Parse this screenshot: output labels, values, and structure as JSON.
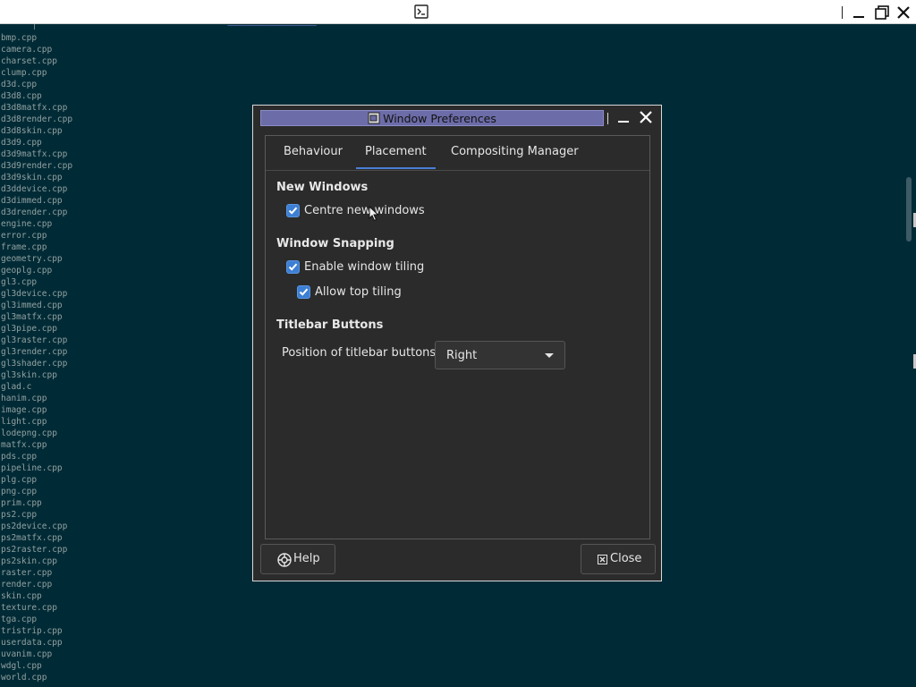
{
  "terminal": {
    "icon": "terminal-icon",
    "files": [
      "bmp.cpp",
      "camera.cpp",
      "charset.cpp",
      "clump.cpp",
      "d3d.cpp",
      "d3d8.cpp",
      "d3d8matfx.cpp",
      "d3d8render.cpp",
      "d3d8skin.cpp",
      "d3d9.cpp",
      "d3d9matfx.cpp",
      "d3d9render.cpp",
      "d3d9skin.cpp",
      "d3ddevice.cpp",
      "d3dimmed.cpp",
      "d3drender.cpp",
      "engine.cpp",
      "error.cpp",
      "frame.cpp",
      "geometry.cpp",
      "geoplg.cpp",
      "gl3.cpp",
      "gl3device.cpp",
      "gl3immed.cpp",
      "gl3matfx.cpp",
      "gl3pipe.cpp",
      "gl3raster.cpp",
      "gl3render.cpp",
      "gl3shader.cpp",
      "gl3skin.cpp",
      "glad.c",
      "hanim.cpp",
      "image.cpp",
      "light.cpp",
      "lodepng.cpp",
      "matfx.cpp",
      "pds.cpp",
      "pipeline.cpp",
      "plg.cpp",
      "png.cpp",
      "prim.cpp",
      "ps2.cpp",
      "ps2device.cpp",
      "ps2matfx.cpp",
      "ps2raster.cpp",
      "ps2skin.cpp",
      "raster.cpp",
      "render.cpp",
      "skin.cpp",
      "texture.cpp",
      "tga.cpp",
      "tristrip.cpp",
      "userdata.cpp",
      "uvanim.cpp",
      "wdgl.cpp",
      "world.cpp"
    ],
    "tildes": "~~~~~~~~~~~~~~~~~~~~~~~~~~"
  },
  "dialog": {
    "title": "Window Preferences",
    "tabs": [
      {
        "label": "Behaviour"
      },
      {
        "label": "Placement"
      },
      {
        "label": "Compositing Manager"
      }
    ],
    "active_tab": "Placement",
    "sections": {
      "new_windows": {
        "title": "New Windows",
        "centre_new_windows": {
          "label": "Centre new windows",
          "checked": true
        }
      },
      "window_snapping": {
        "title": "Window Snapping",
        "enable_tiling": {
          "label": "Enable window tiling",
          "checked": true
        },
        "allow_top_tiling": {
          "label": "Allow top tiling",
          "checked": true
        }
      },
      "titlebar_buttons": {
        "title": "Titlebar Buttons",
        "position_label": "Position of titlebar buttons:",
        "position_value": "Right"
      }
    },
    "buttons": {
      "help": "Help",
      "close": "Close"
    }
  },
  "colors": {
    "terminal_bg": "#002b36",
    "dialog_bg": "#2b2b2b",
    "titlebar": "#6c6ca8",
    "accent": "#3d7fd4"
  }
}
